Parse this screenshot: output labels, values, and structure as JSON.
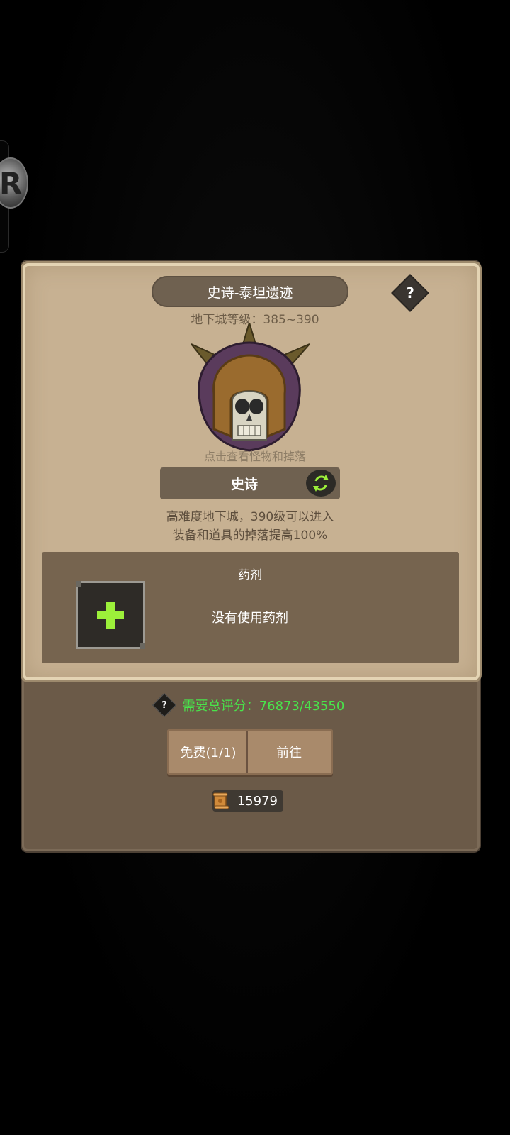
{
  "side_badge": {
    "letter": "R"
  },
  "dungeon": {
    "title": "史诗-泰坦遗迹",
    "level_text": "地下城等级：385~390",
    "hint": "点击查看怪物和掉落",
    "difficulty": "史诗",
    "desc_line1": "高难度地下城，390级可以进入",
    "desc_line2": "装备和道具的掉落提高100%",
    "help_label": "?"
  },
  "potion": {
    "title": "药剂",
    "status": "没有使用药剂"
  },
  "requirement": {
    "icon_label": "?",
    "text": "需要总评分：76873/43550",
    "color": "#49e34b"
  },
  "actions": {
    "free_label": "免费(1/1)",
    "go_label": "前往"
  },
  "currency": {
    "value": "15979"
  },
  "colors": {
    "parchment": "#c7b192",
    "panel": "#6b5a48",
    "plus": "#9cf03a"
  }
}
